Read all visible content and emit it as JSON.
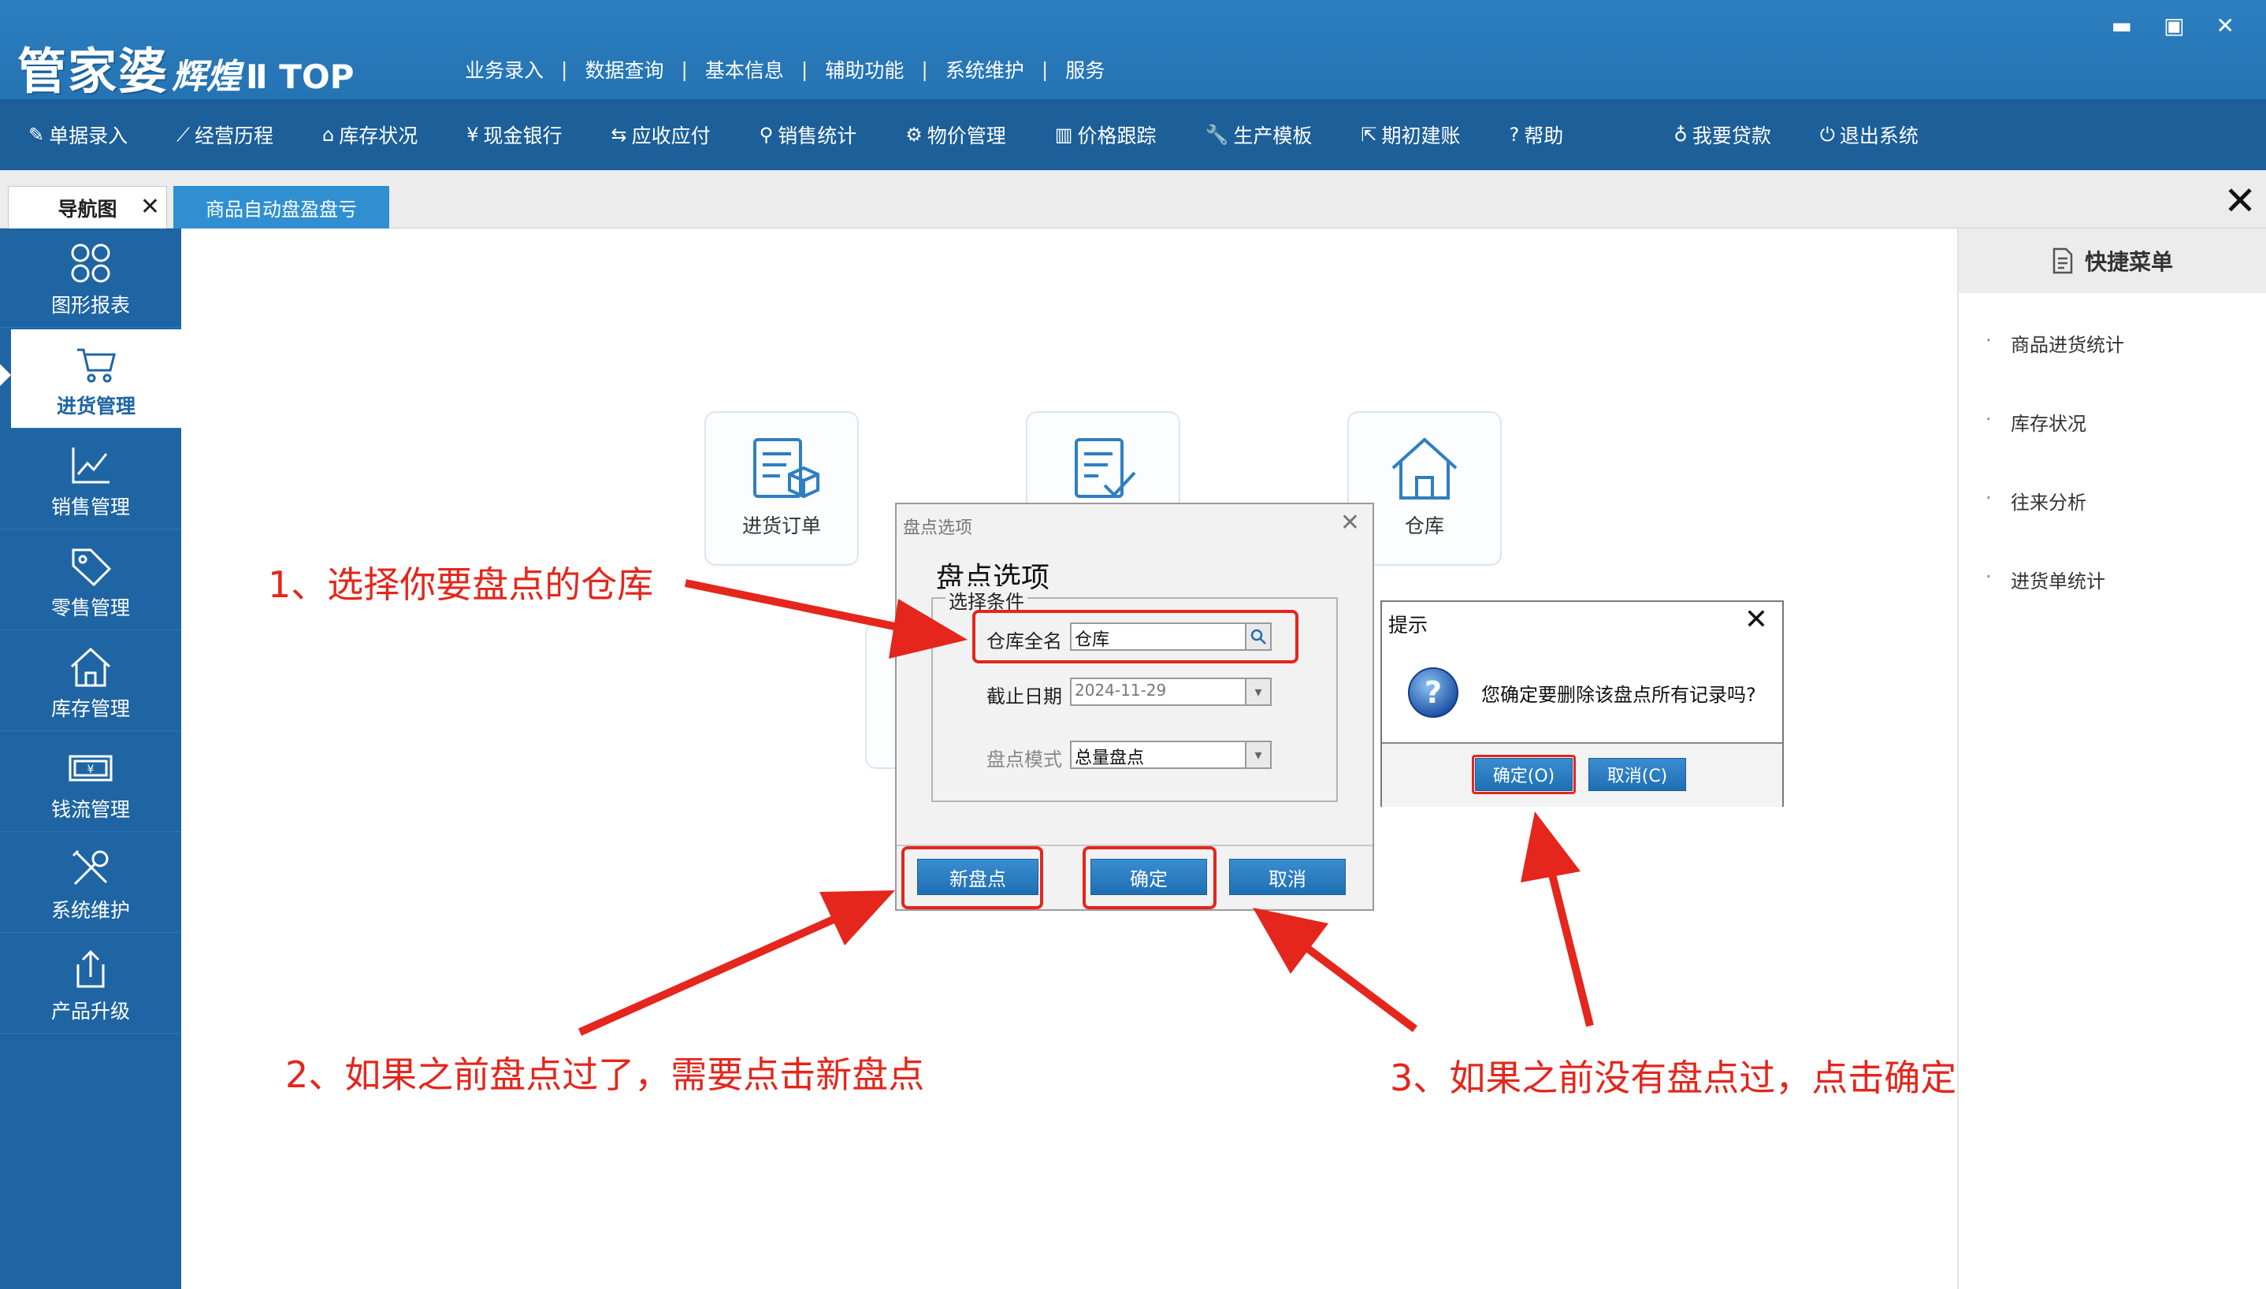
{
  "title_bar": {
    "logo_main": "管家婆",
    "logo_sub": "辉煌",
    "logo_top": "Ⅱ TOP",
    "menu": [
      "业务录入",
      "数据查询",
      "基本信息",
      "辅助功能",
      "系统维护",
      "服务"
    ],
    "window_controls": {
      "minimize": "▬",
      "maximize": "▣",
      "close": "✕"
    }
  },
  "toolbar": {
    "items": [
      {
        "label": "单据录入",
        "icon": "document-edit-icon",
        "glyph": "✎"
      },
      {
        "label": "经营历程",
        "icon": "line-chart-icon",
        "glyph": "⟋"
      },
      {
        "label": "库存状况",
        "icon": "home-icon",
        "glyph": "⌂"
      },
      {
        "label": "现金银行",
        "icon": "yen-icon",
        "glyph": "¥"
      },
      {
        "label": "应收应付",
        "icon": "exchange-arrows-icon",
        "glyph": "⇆"
      },
      {
        "label": "销售统计",
        "icon": "search-icon",
        "glyph": "⚲"
      },
      {
        "label": "物价管理",
        "icon": "gear-icon",
        "glyph": "⚙"
      },
      {
        "label": "价格跟踪",
        "icon": "bar-chart-icon",
        "glyph": "▥"
      },
      {
        "label": "生产模板",
        "icon": "wrench-icon",
        "glyph": "🔧"
      },
      {
        "label": "期初建账",
        "icon": "external-link-icon",
        "glyph": "⇱"
      },
      {
        "label": "帮助",
        "icon": "help-icon",
        "glyph": "?"
      },
      {
        "label": "我要贷款",
        "icon": "money-bag-icon",
        "glyph": "♁"
      },
      {
        "label": "退出系统",
        "icon": "power-icon",
        "glyph": "⏻"
      }
    ]
  },
  "tabs": {
    "nav_label": "导航图",
    "close_glyph": "✕",
    "active_label": "商品自动盘盈盘亏",
    "close_all_glyph": "✕"
  },
  "sidebar": {
    "items": [
      {
        "label": "图形报表",
        "icon": "grid-circles-icon"
      },
      {
        "label": "进货管理",
        "icon": "shopping-cart-icon"
      },
      {
        "label": "销售管理",
        "icon": "trend-chart-icon"
      },
      {
        "label": "零售管理",
        "icon": "price-tag-icon"
      },
      {
        "label": "库存管理",
        "icon": "house-icon"
      },
      {
        "label": "钱流管理",
        "icon": "cash-icon"
      },
      {
        "label": "系统维护",
        "icon": "tools-icon"
      },
      {
        "label": "产品升级",
        "icon": "upload-icon"
      }
    ],
    "active_index": 1
  },
  "quick_menu": {
    "title": "快捷菜单",
    "items": [
      "商品进货统计",
      "库存状况",
      "往来分析",
      "进货单统计"
    ]
  },
  "main_tiles": [
    {
      "label": "进货订单",
      "icon": "purchase-order-icon"
    },
    {
      "label": "",
      "icon": "checklist-icon"
    },
    {
      "label": "仓库",
      "icon": "warehouse-icon"
    }
  ],
  "dialog": {
    "window_title": "盘点选项",
    "heading": "盘点选项",
    "group_legend": "选择条件",
    "fields": {
      "warehouse_label": "仓库全名",
      "warehouse_value": "仓库",
      "date_label": "截止日期",
      "date_value": "2024-11-29",
      "mode_label": "盘点模式",
      "mode_value": "总量盘点"
    },
    "buttons": {
      "new": "新盘点",
      "ok": "确定",
      "cancel": "取消"
    },
    "close_glyph": "✕"
  },
  "confirm_dialog": {
    "title": "提示",
    "message": "您确定要删除该盘点所有记录吗?",
    "buttons": {
      "ok": "确定(O)",
      "cancel": "取消(C)"
    },
    "close_glyph": "✕"
  },
  "annotations": {
    "step1": "1、选择你要盘点的仓库",
    "step2": "2、如果之前盘点过了，需要点击新盘点",
    "step3": "3、如果之前没有盘点过，点击确定"
  },
  "colors": {
    "title_blue": "#2473b3",
    "toolbar_blue": "#1c5f99",
    "sidebar_blue": "#1f65a3",
    "annotation_red": "#e4261c"
  }
}
